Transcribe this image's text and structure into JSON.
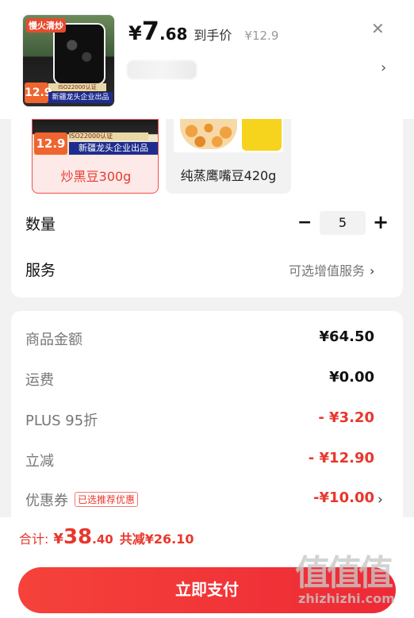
{
  "header": {
    "price_currency": "¥",
    "price_int": "7",
    "price_dec": ".68",
    "price_label": "到手价",
    "original_price": "¥12.9",
    "close_glyph": "✕",
    "thumb": {
      "badge": "慢火清炒",
      "price_tag": "12.9",
      "cert": "ISO22000认证",
      "strip": "新疆龙头企业出品"
    }
  },
  "variants": [
    {
      "label": "炒黑豆300g",
      "selected": true,
      "price_tag": "12.9",
      "cert": "ISO22000认证",
      "strip": "新疆龙头企业出品"
    },
    {
      "label": "纯蒸鹰嘴豆420g",
      "selected": false
    }
  ],
  "quantity": {
    "label": "数量",
    "value": "5",
    "minus": "−",
    "plus": "+"
  },
  "service": {
    "label": "服务",
    "link_text": "可选增值服务",
    "chevron": "›"
  },
  "costs": {
    "goods": {
      "label": "商品金额",
      "value": "¥64.50"
    },
    "shipping": {
      "label": "运费",
      "value": "¥0.00"
    },
    "plus": {
      "label": "PLUS 95折",
      "value": "- ¥3.20"
    },
    "instant": {
      "label": "立减",
      "value": "- ¥12.90"
    },
    "coupon": {
      "label": "优惠券",
      "tag": "已选推荐优惠",
      "value": "-¥10.00"
    }
  },
  "footer": {
    "total_label": "合计:",
    "total_currency": "¥",
    "total_int": "38",
    "total_dec": ".40",
    "savings": "共减¥26.10",
    "pay_button": "立即支付"
  },
  "watermark": {
    "big": "值值值",
    "small": "zhizhizhi.com"
  },
  "colors": {
    "accent": "#e8372c",
    "selected_bg": "#fde9e8",
    "pay_button": "#f0323a"
  }
}
